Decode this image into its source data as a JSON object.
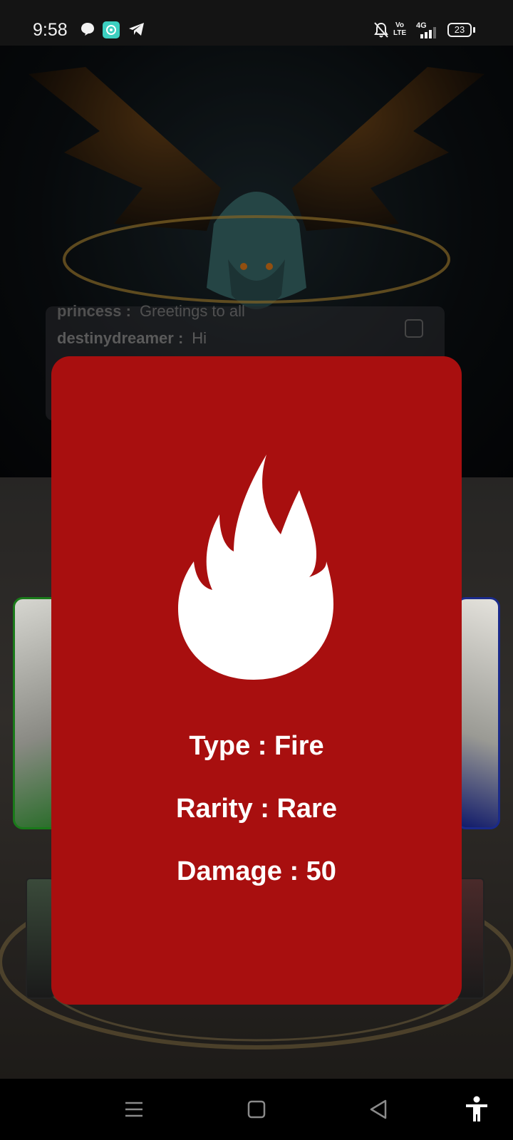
{
  "status_bar": {
    "time": "9:58",
    "battery": "23",
    "network": "4G",
    "volte": "Vo LTE",
    "icons": [
      "chat-bubble-icon",
      "app-icon",
      "telegram-icon",
      "mute-bell-icon",
      "volte-icon",
      "signal-icon",
      "battery-icon"
    ]
  },
  "chat": {
    "line1_user": "princess :",
    "line1_message": "Greetings to all",
    "line2_user": "destinydreamer :",
    "line2_message": "Hi"
  },
  "card": {
    "element_icon": "fire-icon",
    "type_text": "Type : Fire",
    "rarity_text": "Rarity : Rare",
    "damage_text": "Damage : 50",
    "color": "#a80f0f"
  },
  "nav_bar": {
    "icons": [
      "menu-icon",
      "home-icon",
      "back-icon",
      "accessibility-icon"
    ]
  }
}
